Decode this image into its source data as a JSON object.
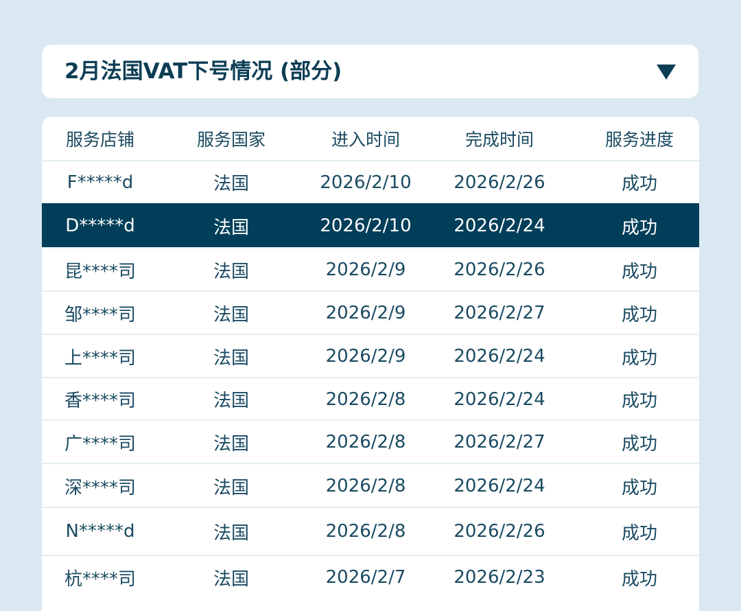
{
  "header": {
    "title": "2月法国VAT下号情况 (部分)",
    "dropdown_icon": "triangle-down-icon"
  },
  "table": {
    "columns": [
      "服务店铺",
      "服务国家",
      "进入时间",
      "完成时间",
      "服务进度"
    ],
    "rows": [
      [
        "F*****d",
        "法国",
        "2026/2/10",
        "2026/2/26",
        "成功"
      ],
      [
        "D*****d",
        "法国",
        "2026/2/10",
        "2026/2/24",
        "成功"
      ],
      [
        "昆****司",
        "法国",
        "2026/2/9",
        "2026/2/26",
        "成功"
      ],
      [
        "邹****司",
        "法国",
        "2026/2/9",
        "2026/2/27",
        "成功"
      ],
      [
        "上****司",
        "法国",
        "2026/2/9",
        "2026/2/24",
        "成功"
      ],
      [
        "香****司",
        "法国",
        "2026/2/8",
        "2026/2/24",
        "成功"
      ],
      [
        "广****司",
        "法国",
        "2026/2/8",
        "2026/2/27",
        "成功"
      ],
      [
        "深****司",
        "法国",
        "2026/2/8",
        "2026/2/24",
        "成功"
      ],
      [
        "N*****d",
        "法国",
        "2026/2/8",
        "2026/2/26",
        "成功"
      ],
      [
        "杭****司",
        "法国",
        "2026/2/7",
        "2026/2/23",
        "成功"
      ]
    ],
    "highlighted_row": 1
  },
  "colors": {
    "background": "#dae8f2",
    "text": "#0c3d54",
    "highlight": "#003e59"
  }
}
